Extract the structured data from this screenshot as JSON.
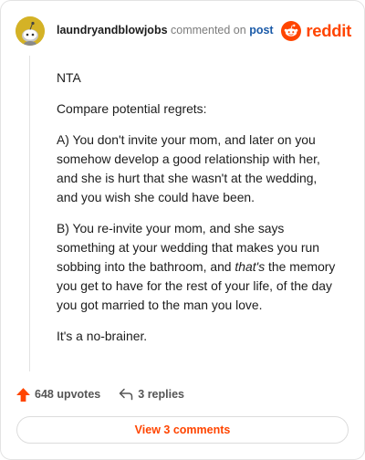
{
  "header": {
    "username": "laundryandblowjobs",
    "commented_text": "commented on",
    "post_link": "post",
    "brand": "reddit"
  },
  "comment": {
    "paragraphs": [
      "NTA",
      "Compare potential regrets:",
      "A) You don't invite your mom, and later on you somehow develop a good relationship with her, and she is hurt that she wasn't at the wedding, and you wish she could have been.",
      "It's a no-brainer."
    ],
    "b_part1": "B) You re-invite your mom, and she says something at your wedding that makes you run sobbing into the bathroom, and ",
    "b_emphasis": "that's",
    "b_part2": " the memory you get to have for the rest of your life, of the day you got married to the man you love."
  },
  "actions": {
    "upvotes": "648 upvotes",
    "replies": "3 replies"
  },
  "view_button": "View 3 comments",
  "colors": {
    "accent": "#ff4500",
    "link": "#1a5aa8",
    "avatar": "#d4b226"
  }
}
